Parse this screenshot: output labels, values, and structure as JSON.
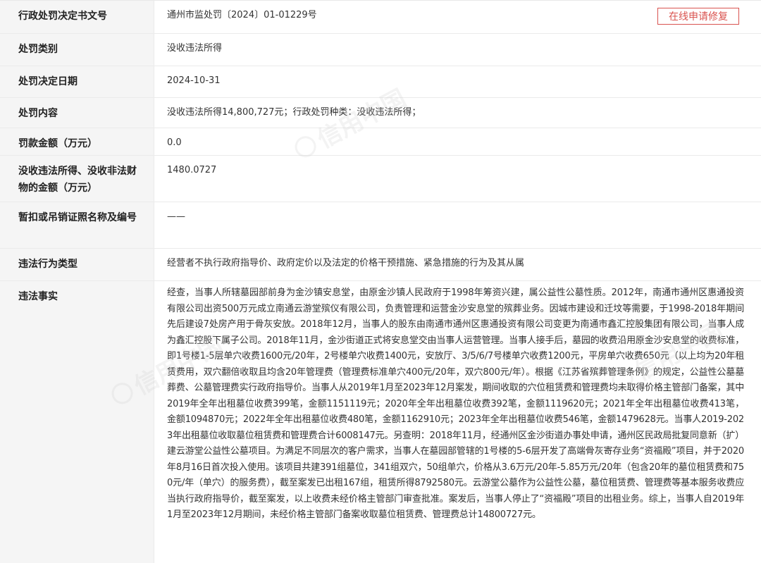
{
  "rows": [
    {
      "label": "行政处罚决定书文号",
      "value": "通州市监处罚〔2024〕01-01229号"
    },
    {
      "label": "处罚类别",
      "value": "没收违法所得"
    },
    {
      "label": "处罚决定日期",
      "value": "2024-10-31"
    },
    {
      "label": "处罚内容",
      "value": "没收违法所得14,800,727元；行政处罚种类：没收违法所得；"
    },
    {
      "label": "罚款金额（万元）",
      "value": "0.0"
    },
    {
      "label": "没收违法所得、没收非法财物的金额（万元）",
      "value": "1480.0727"
    },
    {
      "label": "暂扣或吊销证照名称及编号",
      "value": "——"
    },
    {
      "label": "违法行为类型",
      "value": "经营者不执行政府指导价、政府定价以及法定的价格干预措施、紧急措施的行为及其从属"
    },
    {
      "label": "违法事实",
      "value": "经查，当事人所辖墓园部前身为金沙镇安息堂，由原金沙镇人民政府于1998年筹资兴建，属公益性公墓性质。2012年，南通市通州区惠通投资有限公司出资500万元成立南通云游堂殡仪有限公司，负责管理和运营金沙安息堂的殡葬业务。因城市建设和迁坟等需要，于1998-2018年期间先后建设7处房产用于骨灰安放。2018年12月，当事人的股东由南通市通州区惠通投资有限公司变更为南通市鑫汇控股集团有限公司，当事人成为鑫汇控股下属子公司。2018年11月，金沙街道正式将安息堂交由当事人运营管理。当事人接手后，墓园的收费沿用原金沙安息堂的收费标准，即1号楼1-5层单穴收费1600元/20年，2号楼单穴收费1400元，安放厅、3/5/6/7号楼单穴收费1200元，平房单穴收费650元（以上均为20年租赁费用，双穴翻倍收取且均含20年管理费（管理费标准单穴400元/20年，双穴800元/年）。根据《江苏省殡葬管理条例》的规定，公益性公墓墓葬费、公墓管理费实行政府指导价。当事人从2019年1月至2023年12月案发，期间收取的穴位租赁费和管理费均未取得价格主管部门备案，其中2019年全年出租墓位收费399笔，金额1151119元；2020年全年出租墓位收费392笔，金额1119620元；2021年全年出租墓位收费413笔，金额1094870元；2022年全年出租墓位收费480笔，金额1162910元；2023年全年出租墓位收费546笔，金额1479628元。当事人2019-2023年出租墓位收取墓位租赁费和管理费合计6008147元。另查明：2018年11月，经通州区金沙街道办事处申请，通州区民政局批复同意新（扩）建云游堂公益性公墓项目。为满足不同层次的客户需求，当事人在墓园部管辖的1号楼的5-6层开发了高端骨灰寄存业务“资福殿”项目，并于2020年8月16日首次投入使用。该项目共建391组墓位，341组双穴，50组单穴，价格从3.6万元/20年-5.85万元/20年（包含20年的墓位租赁费和750元/年（单穴）的服务费），截至案发已出租167组，租赁所得8792580元。云游堂公墓作为公益性公墓，墓位租赁费、管理费等基本服务收费应当执行政府指导价，截至案发，以上收费未经价格主管部门审查批准。案发后，当事人停止了“资福殿”项目的出租业务。综上，当事人自2019年1月至2023年12月期间，未经价格主管部门备案收取墓位租赁费、管理费总计14800727元。"
    }
  ],
  "repair_button_label": "在线申请修复",
  "watermark_text": "信用中国",
  "colors": {
    "label_bg": "#f5f5f5",
    "border": "#ebebeb",
    "accent_red": "#d9534f",
    "text": "#333333"
  }
}
